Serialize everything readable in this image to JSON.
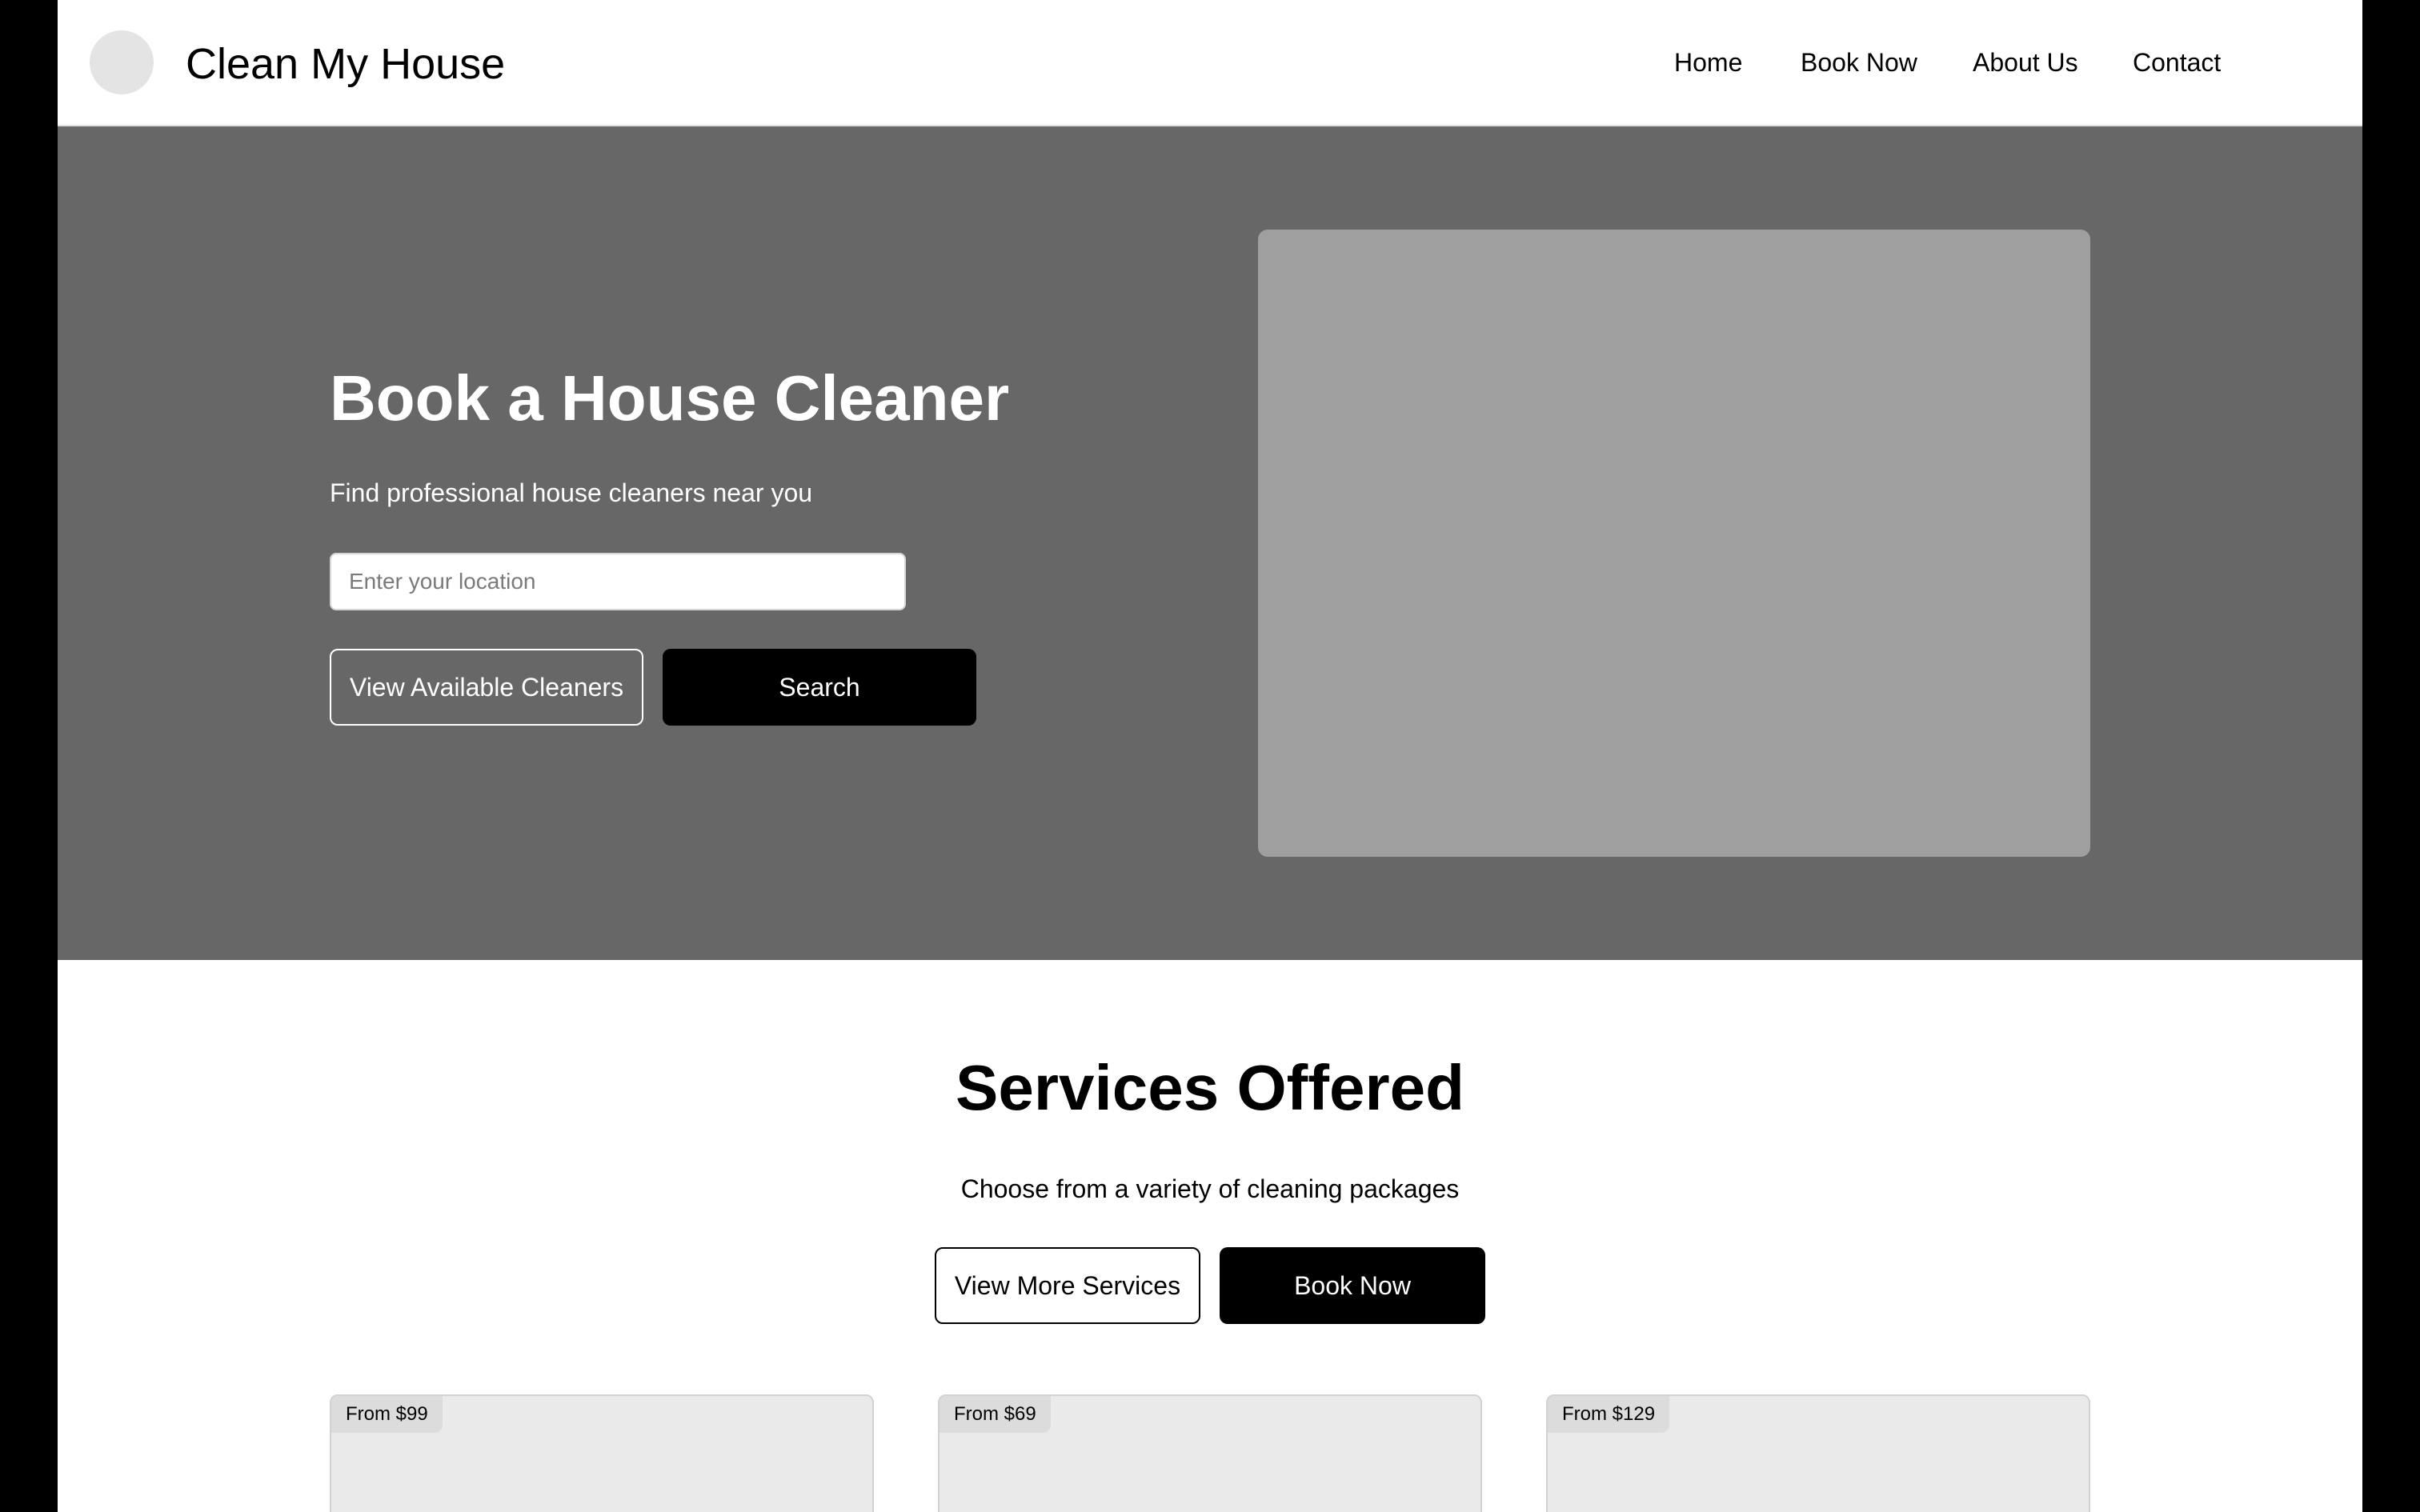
{
  "header": {
    "brand": "Clean My House",
    "nav": [
      "Home",
      "Book Now",
      "About Us",
      "Contact"
    ]
  },
  "hero": {
    "title": "Book a House Cleaner",
    "subtitle": "Find professional house cleaners near you",
    "location_placeholder": "Enter your location",
    "location_value": "",
    "view_cleaners_label": "View Available Cleaners",
    "search_label": "Search"
  },
  "services": {
    "title": "Services Offered",
    "subtitle": "Choose from a variety of cleaning packages",
    "view_more_label": "View More Services",
    "book_now_label": "Book Now",
    "cards": [
      {
        "price": "From $99"
      },
      {
        "price": "From $69"
      },
      {
        "price": "From $129"
      }
    ]
  },
  "colors": {
    "hero_background": "#676767",
    "image_placeholder": "#9f9f9f",
    "card_background": "#eaeaea",
    "primary_button": "#000000"
  }
}
